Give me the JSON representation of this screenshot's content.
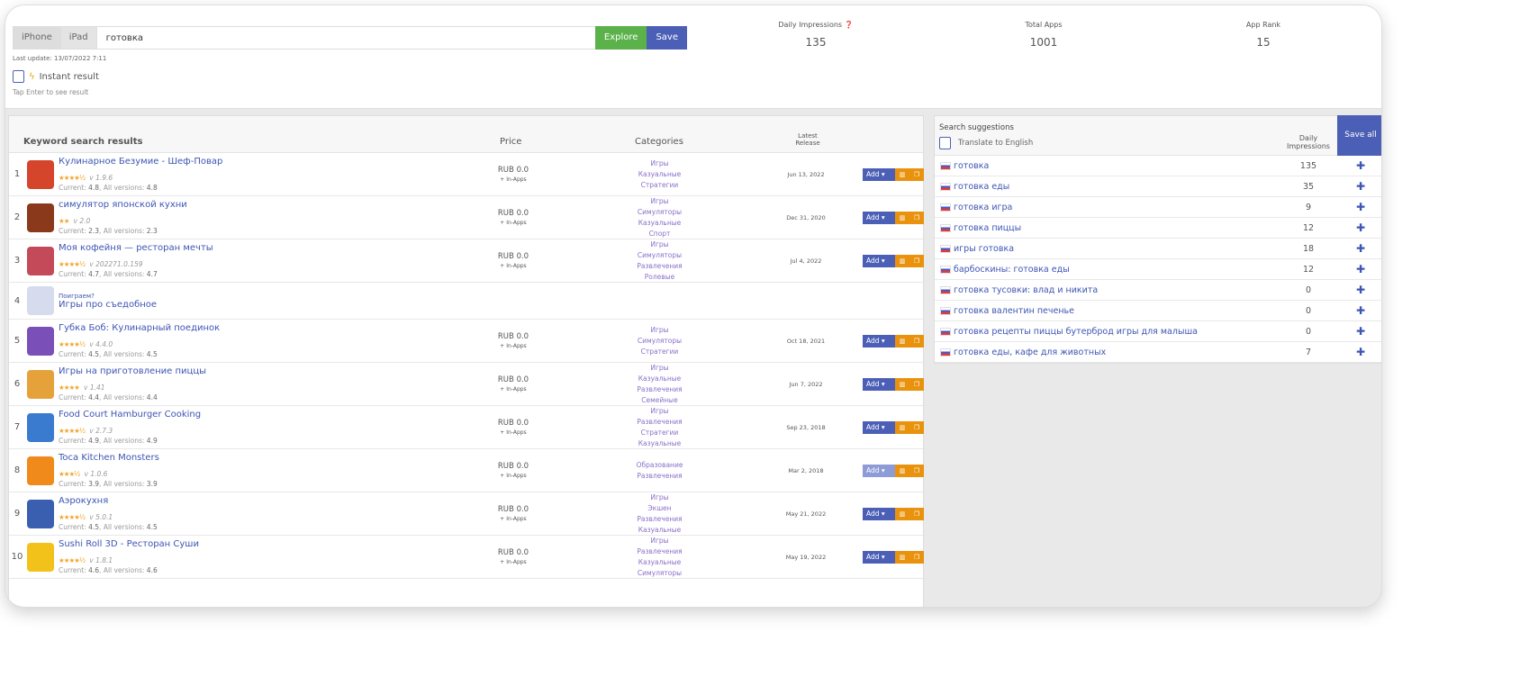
{
  "search": {
    "devices": [
      "iPhone",
      "iPad"
    ],
    "query": "готовка",
    "explore": "Explore",
    "save": "Save",
    "last_update": "Last update: 13/07/2022 7:11",
    "instant": "Instant result",
    "tap_hint": "Tap Enter to see result"
  },
  "stats": [
    {
      "label": "Daily Impressions",
      "value": "135"
    },
    {
      "label": "Total Apps",
      "value": "1001"
    },
    {
      "label": "App Rank",
      "value": "15"
    }
  ],
  "results": {
    "headers": {
      "title": "Keyword search results",
      "price": "Price",
      "categories": "Categories",
      "release": "Latest Release"
    },
    "add_label": "Add",
    "rows": [
      {
        "rank": "1",
        "title": "Кулинарное Безумие - Шеф-Повар",
        "stars": "★★★★½",
        "version": "v 1.9.6",
        "current": "4.8",
        "all": "4.8",
        "price": "RUB 0.0",
        "inapps": "+ In-Apps",
        "cats": [
          "Игры",
          "Казуальные",
          "Стратегии"
        ],
        "date": "Jun 13, 2022",
        "color": "#d4452c"
      },
      {
        "rank": "2",
        "title": "симулятор японской кухни",
        "stars": "★★",
        "version": "v 2.0",
        "current": "2.3",
        "all": "2.3",
        "price": "RUB 0.0",
        "inapps": "+ In-Apps",
        "cats": [
          "Игры",
          "Симуляторы",
          "Казуальные",
          "Спорт"
        ],
        "date": "Dec 31, 2020",
        "color": "#8a3a1a"
      },
      {
        "rank": "3",
        "title": "Моя кофейня — ресторан мечты",
        "stars": "★★★★½",
        "version": "v 202271.0.159",
        "current": "4.7",
        "all": "4.7",
        "price": "RUB 0.0",
        "inapps": "+ In-Apps",
        "cats": [
          "Игры",
          "Симуляторы",
          "Развлечения",
          "Ролевые"
        ],
        "date": "Jul 4, 2022",
        "color": "#c44a5a"
      },
      {
        "rank": "4",
        "ad": "Поиграем?",
        "title": "Игры про съедобное",
        "color": "#d6dbee"
      },
      {
        "rank": "5",
        "title": "Губка Боб: Кулинарный поединок",
        "stars": "★★★★½",
        "version": "v 4.4.0",
        "current": "4.5",
        "all": "4.5",
        "price": "RUB 0.0",
        "inapps": "+ In-Apps",
        "cats": [
          "Игры",
          "Симуляторы",
          "Стратегии"
        ],
        "date": "Oct 18, 2021",
        "color": "#7b4fb8"
      },
      {
        "rank": "6",
        "title": "Игры на приготовление пиццы",
        "stars": "★★★★",
        "version": "v 1.41",
        "current": "4.4",
        "all": "4.4",
        "price": "RUB 0.0",
        "inapps": "+ In-Apps",
        "cats": [
          "Игры",
          "Казуальные",
          "Развлечения",
          "Семейные"
        ],
        "date": "Jun 7, 2022",
        "color": "#e6a23a"
      },
      {
        "rank": "7",
        "title": "Food Court Hamburger Cooking",
        "stars": "★★★★½",
        "version": "v 2.7.3",
        "current": "4.9",
        "all": "4.9",
        "price": "RUB 0.0",
        "inapps": "+ In-Apps",
        "cats": [
          "Игры",
          "Развлечения",
          "Стратегии",
          "Казуальные"
        ],
        "date": "Sep 23, 2018",
        "color": "#3a7bd0"
      },
      {
        "rank": "8",
        "title": "Toca Kitchen Monsters",
        "stars": "★★★½",
        "version": "v 1.0.6",
        "current": "3.9",
        "all": "3.9",
        "price": "RUB 0.0",
        "inapps": "+ In-Apps",
        "cats": [
          "Образование",
          "Развлечения"
        ],
        "date": "Mar 2, 2018",
        "color": "#f08a1a",
        "disabled": true
      },
      {
        "rank": "9",
        "title": "Аэрокухня",
        "stars": "★★★★½",
        "version": "v 5.0.1",
        "current": "4.5",
        "all": "4.5",
        "price": "RUB 0.0",
        "inapps": "+ In-Apps",
        "cats": [
          "Игры",
          "Экшен",
          "Развлечения",
          "Казуальные"
        ],
        "date": "May 21, 2022",
        "color": "#3b5fb0"
      },
      {
        "rank": "10",
        "title": "Sushi Roll 3D - Ресторан Суши",
        "stars": "★★★★½",
        "version": "v 1.8.1",
        "current": "4.6",
        "all": "4.6",
        "price": "RUB 0.0",
        "inapps": "+ In-Apps",
        "cats": [
          "Игры",
          "Развлечения",
          "Казуальные",
          "Симуляторы"
        ],
        "date": "May 19, 2022",
        "color": "#f2c21a"
      }
    ],
    "current_label": "Current:",
    "all_label": "All versions:"
  },
  "suggestions": {
    "title": "Search suggestions",
    "translate": "Translate to English",
    "impressions_header": "Daily Impressions",
    "save_all": "Save all",
    "rows": [
      {
        "kw": "готовка",
        "imp": "135"
      },
      {
        "kw": "готовка еды",
        "imp": "35"
      },
      {
        "kw": "готовка игра",
        "imp": "9"
      },
      {
        "kw": "готовка пиццы",
        "imp": "12"
      },
      {
        "kw": "игры готовка",
        "imp": "18"
      },
      {
        "kw": "барбоскины: готовка еды",
        "imp": "12"
      },
      {
        "kw": "готовка тусовки: влад и никита",
        "imp": "0"
      },
      {
        "kw": "готовка валентин печенье",
        "imp": "0"
      },
      {
        "kw": "готовка рецепты пиццы бутерброд игры для малыша",
        "imp": "0"
      },
      {
        "kw": "готовка еды, кафе для животных",
        "imp": "7"
      }
    ]
  }
}
